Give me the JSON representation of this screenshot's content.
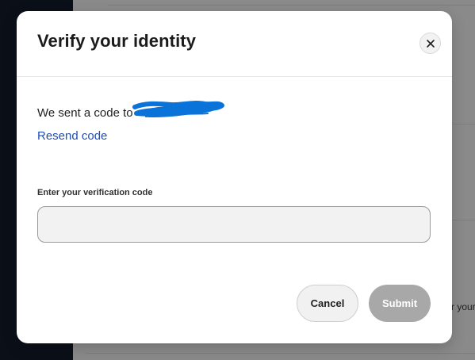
{
  "background": {
    "peek_text": "r your"
  },
  "modal": {
    "title": "Verify your identity",
    "close_icon": "close-icon",
    "message_prefix": "We sent a code to",
    "redacted_value_visible": false,
    "resend_label": "Resend code",
    "field_label": "Enter your verification code",
    "input_value": "",
    "input_placeholder": "",
    "cancel_label": "Cancel",
    "submit_label": "Submit",
    "submit_disabled": true
  },
  "colors": {
    "link": "#1e4fb8",
    "redaction_scribble": "#0a73d9",
    "submit_disabled_bg": "#a8a8a8"
  }
}
